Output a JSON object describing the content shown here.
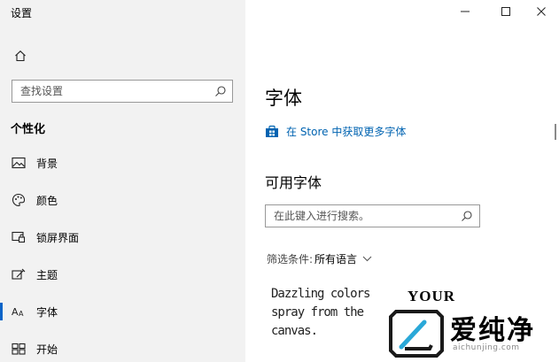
{
  "window": {
    "title": "设置",
    "controls": {
      "minimize": "minimize",
      "maximize": "maximize",
      "close": "close"
    }
  },
  "sidebar": {
    "home_icon": "home-icon",
    "search": {
      "placeholder": "查找设置",
      "icon": "search-icon"
    },
    "section_title": "个性化",
    "items": [
      {
        "label": "背景",
        "icon": "picture-icon",
        "active": false
      },
      {
        "label": "颜色",
        "icon": "palette-icon",
        "active": false
      },
      {
        "label": "锁屏界面",
        "icon": "lock-screen-icon",
        "active": false
      },
      {
        "label": "主题",
        "icon": "theme-icon",
        "active": false
      },
      {
        "label": "字体",
        "icon": "font-icon",
        "active": true
      },
      {
        "label": "开始",
        "icon": "start-icon",
        "active": false
      }
    ],
    "active_indicator_color": "#0a64c8"
  },
  "main": {
    "title": "字体",
    "store_link": {
      "label": "在 Store 中获取更多字体",
      "icon": "store-icon",
      "color": "#0063b1"
    },
    "available_title": "可用字体",
    "font_search": {
      "placeholder": "在此键入进行搜索。",
      "icon": "search-icon"
    },
    "filter": {
      "label": "筛选条件:",
      "value": "所有语言"
    },
    "previews": [
      "Dazzling colors spray from the canvas.",
      "YOUR"
    ]
  },
  "watermark": {
    "text": "爱纯净",
    "url": "aichunjing.com"
  }
}
